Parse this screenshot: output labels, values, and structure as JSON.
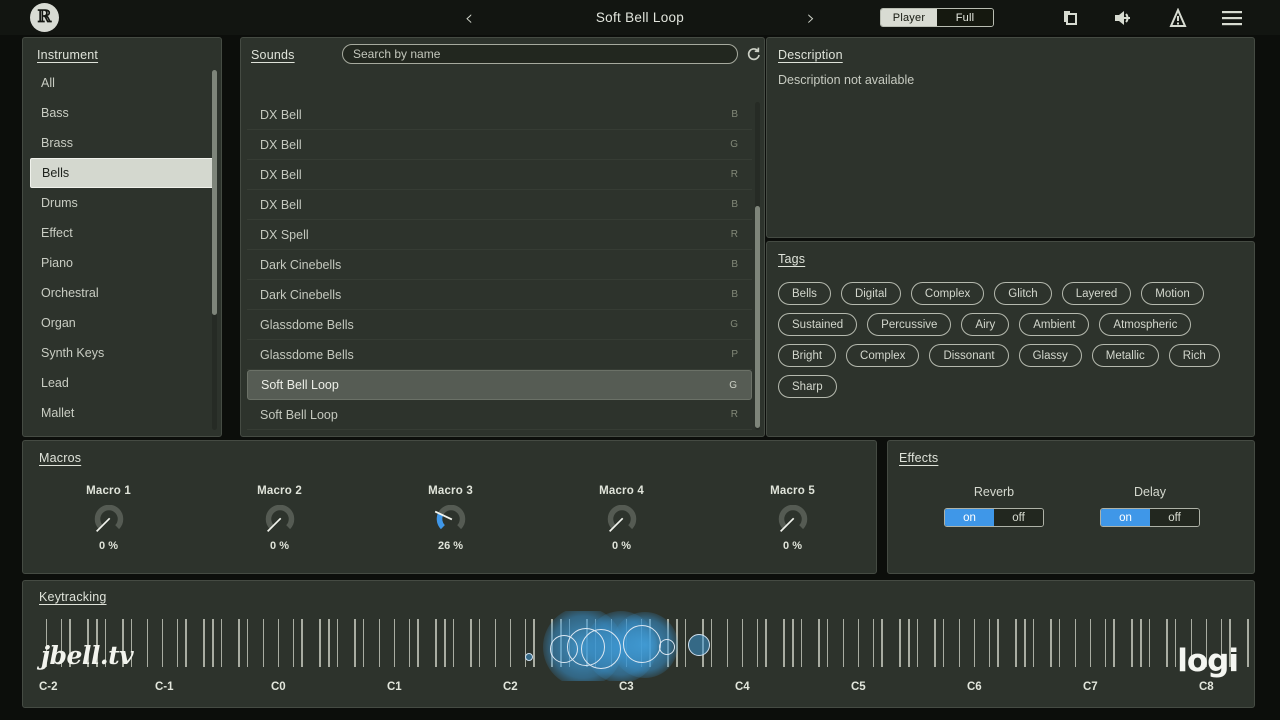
{
  "topbar": {
    "brand_logo": "roland-r-logo",
    "prev_label": "‹",
    "next_label": "›",
    "preset_title": "Soft Bell Loop",
    "mode_player": "Player",
    "mode_full": "Full",
    "mode_selected": "Player",
    "icons": [
      "duplicate-icon",
      "speaker-icon",
      "warning-icon",
      "menu-icon"
    ]
  },
  "instrument": {
    "title": "Instrument",
    "selected": "Bells",
    "items": [
      {
        "label": "All"
      },
      {
        "label": "Bass"
      },
      {
        "label": "Brass"
      },
      {
        "label": "Bells"
      },
      {
        "label": "Drums"
      },
      {
        "label": "Effect"
      },
      {
        "label": "Piano"
      },
      {
        "label": "Orchestral"
      },
      {
        "label": "Organ"
      },
      {
        "label": "Synth Keys"
      },
      {
        "label": "Lead"
      },
      {
        "label": "Mallet"
      }
    ]
  },
  "sounds": {
    "title": "Sounds",
    "search_placeholder": "Search by name",
    "search_value": "",
    "refresh_icon": "refresh-icon",
    "selected": "Soft Bell Loop",
    "rows": [
      {
        "name": "DX Bell",
        "badge": "B"
      },
      {
        "name": "DX Bell",
        "badge": "G"
      },
      {
        "name": "DX Bell",
        "badge": "R"
      },
      {
        "name": "DX Bell",
        "badge": "B"
      },
      {
        "name": "DX Spell",
        "badge": "R"
      },
      {
        "name": "Dark Cinebells",
        "badge": "B"
      },
      {
        "name": "Dark Cinebells",
        "badge": "B"
      },
      {
        "name": "Glassdome Bells",
        "badge": "G"
      },
      {
        "name": "Glassdome Bells",
        "badge": "P"
      },
      {
        "name": "Soft Bell Loop",
        "badge": "G"
      },
      {
        "name": "Soft Bell Loop",
        "badge": "R"
      }
    ]
  },
  "description": {
    "title": "Description",
    "text": "Description not available"
  },
  "tags": {
    "title": "Tags",
    "items": [
      "Bells",
      "Digital",
      "Complex",
      "Glitch",
      "Layered",
      "Motion",
      "Sustained",
      "Percussive",
      "Airy",
      "Ambient",
      "Atmospheric",
      "Bright",
      "Complex",
      "Dissonant",
      "Glassy",
      "Metallic",
      "Rich",
      "Sharp"
    ]
  },
  "macros": {
    "title": "Macros",
    "items": [
      {
        "name": "Macro 1",
        "value": "0 %",
        "percent": 0
      },
      {
        "name": "Macro 2",
        "value": "0 %",
        "percent": 0
      },
      {
        "name": "Macro 3",
        "value": "26 %",
        "percent": 26
      },
      {
        "name": "Macro 4",
        "value": "0 %",
        "percent": 0
      },
      {
        "name": "Macro 5",
        "value": "0 %",
        "percent": 0
      }
    ]
  },
  "effects": {
    "title": "Effects",
    "items": [
      {
        "name": "Reverb",
        "on_label": "on",
        "off_label": "off",
        "state": "on"
      },
      {
        "name": "Delay",
        "on_label": "on",
        "off_label": "off",
        "state": "on"
      }
    ]
  },
  "keytracking": {
    "title": "Keytracking",
    "octave_labels": [
      "C-2",
      "C-1",
      "C0",
      "C1",
      "C2",
      "C3",
      "C4",
      "C5",
      "C6",
      "C7",
      "C8"
    ],
    "watermark_left": "jbell.tv",
    "watermark_right": "logi"
  },
  "colors": {
    "panel_bg": "#2d332c",
    "topbar_bg": "#121511",
    "accent_blue": "#3f97e8",
    "text": "#d3d7cd",
    "selection": "#d4d8cf"
  }
}
